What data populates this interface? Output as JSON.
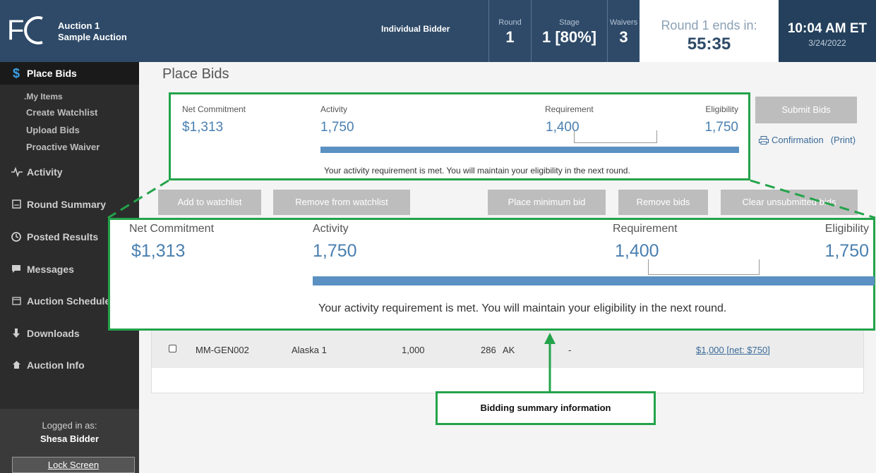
{
  "header": {
    "auction_line1": "Auction 1",
    "auction_line2": "Sample Auction",
    "bidder_type": "Individual Bidder",
    "round_label": "Round",
    "round_value": "1",
    "stage_label": "Stage",
    "stage_value": "1 [80%]",
    "waivers_label": "Waivers",
    "waivers_value": "3",
    "ends_label": "Round 1 ends in:",
    "ends_value": "55:35",
    "time": "10:04 AM ET",
    "date": "3/24/2022",
    "colors": {
      "header_bg": "#2e4a68",
      "accent": "#23a34a"
    }
  },
  "sidebar": {
    "active": "Place Bids",
    "sub_items": [
      "My Items",
      "Create Watchlist",
      "Upload Bids",
      "Proactive Waiver"
    ],
    "items": [
      {
        "label": "Activity",
        "icon": "activity-icon"
      },
      {
        "label": "Round Summary",
        "icon": "round-summary-icon"
      },
      {
        "label": "Posted Results",
        "icon": "posted-results-icon"
      },
      {
        "label": "Messages",
        "icon": "messages-icon"
      },
      {
        "label": "Auction Schedule",
        "icon": "calendar-icon"
      },
      {
        "label": "Downloads",
        "icon": "download-icon"
      },
      {
        "label": "Auction Info",
        "icon": "home-icon"
      }
    ],
    "logged_in_label": "Logged in as:",
    "logged_in_name": "Shesa Bidder",
    "lock_screen": "Lock Screen"
  },
  "main": {
    "title": "Place Bids",
    "summary": {
      "net_commitment_label": "Net Commitment",
      "net_commitment_value": "$1,313",
      "activity_label": "Activity",
      "activity_value": "1,750",
      "requirement_label": "Requirement",
      "requirement_value": "1,400",
      "eligibility_label": "Eligibility",
      "eligibility_value": "1,750",
      "message": "Your activity requirement is met. You will maintain your eligibility in the next round."
    },
    "submit_bids": "Submit Bids",
    "confirmation": "Confirmation",
    "print": "(Print)",
    "buttons": {
      "add_watchlist": "Add to watchlist",
      "remove_watchlist": "Remove from watchlist",
      "place_min_bid": "Place minimum bid",
      "remove_bids": "Remove bids",
      "clear_unsubmitted": "Clear unsubmitted bids"
    },
    "table_row": {
      "id": "MM-GEN002",
      "name": "Alaska 1",
      "value1": "1,000",
      "value2": "286",
      "state": "AK",
      "dash": "-",
      "bid": "$1,000 [net: $750]"
    },
    "callout": "Bidding summary information"
  }
}
